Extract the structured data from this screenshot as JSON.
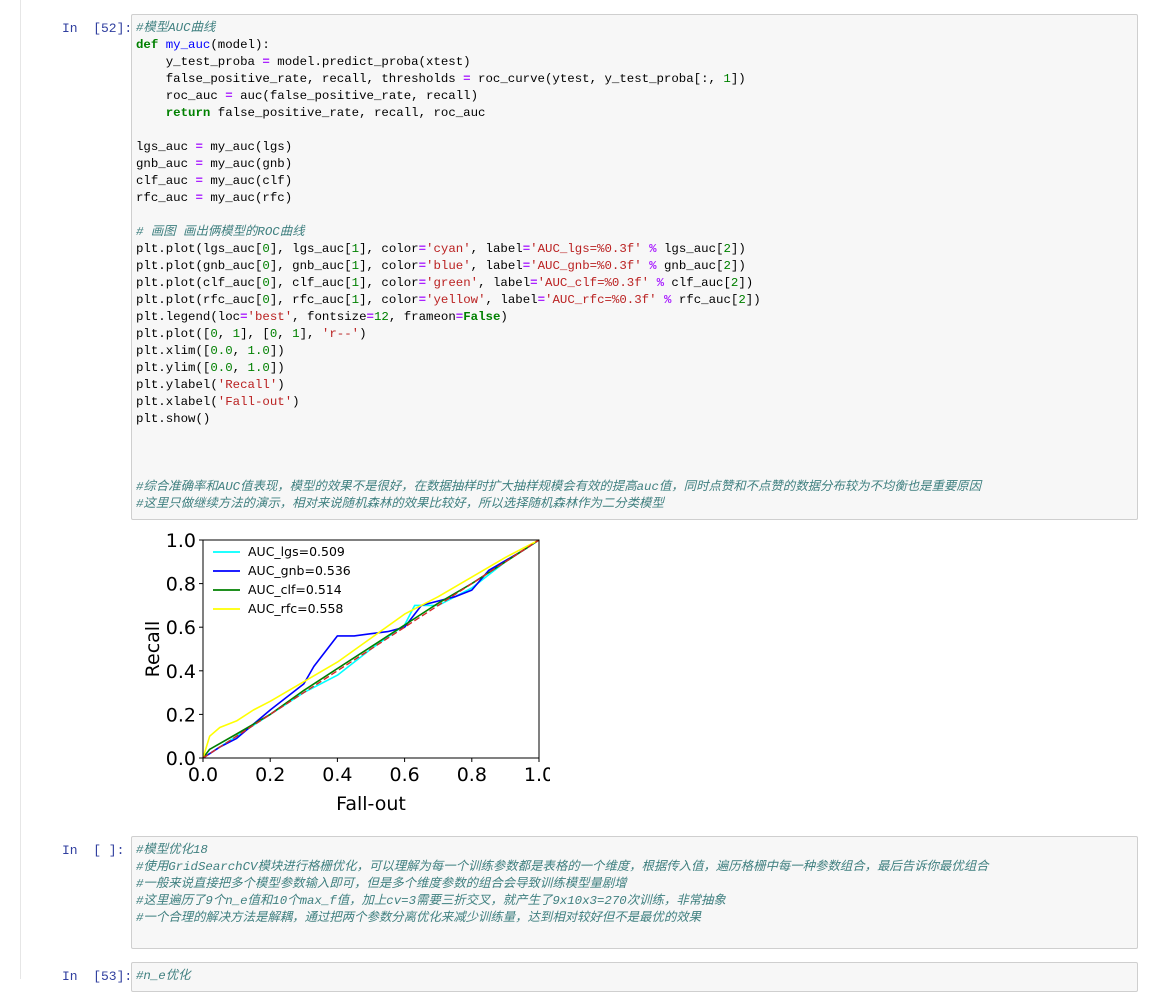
{
  "cells": [
    {
      "prompt": "In  [52]:",
      "lines": [
        [
          {
            "t": "#模型AUC曲线",
            "c": "cm"
          }
        ],
        [
          {
            "t": "def",
            "c": "kw"
          },
          {
            "t": " "
          },
          {
            "t": "my_auc",
            "c": "fn"
          },
          {
            "t": "(model):"
          }
        ],
        [
          {
            "t": "    y_test_proba "
          },
          {
            "t": "=",
            "c": "op"
          },
          {
            "t": " model.predict_proba(xtest)"
          }
        ],
        [
          {
            "t": "    false_positive_rate, recall, thresholds "
          },
          {
            "t": "=",
            "c": "op"
          },
          {
            "t": " roc_curve(ytest, y_test_proba[:, "
          },
          {
            "t": "1",
            "c": "nm"
          },
          {
            "t": "])"
          }
        ],
        [
          {
            "t": "    roc_auc "
          },
          {
            "t": "=",
            "c": "op"
          },
          {
            "t": " auc(false_positive_rate, recall)"
          }
        ],
        [
          {
            "t": "    "
          },
          {
            "t": "return",
            "c": "kw"
          },
          {
            "t": " false_positive_rate, recall, roc_auc"
          }
        ],
        [],
        [
          {
            "t": "lgs_auc "
          },
          {
            "t": "=",
            "c": "op"
          },
          {
            "t": " my_auc(lgs)"
          }
        ],
        [
          {
            "t": "gnb_auc "
          },
          {
            "t": "=",
            "c": "op"
          },
          {
            "t": " my_auc(gnb)"
          }
        ],
        [
          {
            "t": "clf_auc "
          },
          {
            "t": "=",
            "c": "op"
          },
          {
            "t": " my_auc(clf)"
          }
        ],
        [
          {
            "t": "rfc_auc "
          },
          {
            "t": "=",
            "c": "op"
          },
          {
            "t": " my_auc(rfc)"
          }
        ],
        [],
        [
          {
            "t": "# 画图 画出俩模型的ROC曲线",
            "c": "cm"
          }
        ],
        [
          {
            "t": "plt.plot(lgs_auc["
          },
          {
            "t": "0",
            "c": "nm"
          },
          {
            "t": "], lgs_auc["
          },
          {
            "t": "1",
            "c": "nm"
          },
          {
            "t": "], color"
          },
          {
            "t": "=",
            "c": "op"
          },
          {
            "t": "'cyan'",
            "c": "st"
          },
          {
            "t": ", label"
          },
          {
            "t": "=",
            "c": "op"
          },
          {
            "t": "'AUC_lgs=%0.3f'",
            "c": "st"
          },
          {
            "t": " "
          },
          {
            "t": "%",
            "c": "op"
          },
          {
            "t": " lgs_auc["
          },
          {
            "t": "2",
            "c": "nm"
          },
          {
            "t": "])"
          }
        ],
        [
          {
            "t": "plt.plot(gnb_auc["
          },
          {
            "t": "0",
            "c": "nm"
          },
          {
            "t": "], gnb_auc["
          },
          {
            "t": "1",
            "c": "nm"
          },
          {
            "t": "], color"
          },
          {
            "t": "=",
            "c": "op"
          },
          {
            "t": "'blue'",
            "c": "st"
          },
          {
            "t": ", label"
          },
          {
            "t": "=",
            "c": "op"
          },
          {
            "t": "'AUC_gnb=%0.3f'",
            "c": "st"
          },
          {
            "t": " "
          },
          {
            "t": "%",
            "c": "op"
          },
          {
            "t": " gnb_auc["
          },
          {
            "t": "2",
            "c": "nm"
          },
          {
            "t": "])"
          }
        ],
        [
          {
            "t": "plt.plot(clf_auc["
          },
          {
            "t": "0",
            "c": "nm"
          },
          {
            "t": "], clf_auc["
          },
          {
            "t": "1",
            "c": "nm"
          },
          {
            "t": "], color"
          },
          {
            "t": "=",
            "c": "op"
          },
          {
            "t": "'green'",
            "c": "st"
          },
          {
            "t": ", label"
          },
          {
            "t": "=",
            "c": "op"
          },
          {
            "t": "'AUC_clf=%0.3f'",
            "c": "st"
          },
          {
            "t": " "
          },
          {
            "t": "%",
            "c": "op"
          },
          {
            "t": " clf_auc["
          },
          {
            "t": "2",
            "c": "nm"
          },
          {
            "t": "])"
          }
        ],
        [
          {
            "t": "plt.plot(rfc_auc["
          },
          {
            "t": "0",
            "c": "nm"
          },
          {
            "t": "], rfc_auc["
          },
          {
            "t": "1",
            "c": "nm"
          },
          {
            "t": "], color"
          },
          {
            "t": "=",
            "c": "op"
          },
          {
            "t": "'yellow'",
            "c": "st"
          },
          {
            "t": ", label"
          },
          {
            "t": "=",
            "c": "op"
          },
          {
            "t": "'AUC_rfc=%0.3f'",
            "c": "st"
          },
          {
            "t": " "
          },
          {
            "t": "%",
            "c": "op"
          },
          {
            "t": " rfc_auc["
          },
          {
            "t": "2",
            "c": "nm"
          },
          {
            "t": "])"
          }
        ],
        [
          {
            "t": "plt.legend(loc"
          },
          {
            "t": "=",
            "c": "op"
          },
          {
            "t": "'best'",
            "c": "st"
          },
          {
            "t": ", fontsize"
          },
          {
            "t": "=",
            "c": "op"
          },
          {
            "t": "12",
            "c": "nm"
          },
          {
            "t": ", frameon"
          },
          {
            "t": "=",
            "c": "op"
          },
          {
            "t": "False",
            "c": "kc"
          },
          {
            "t": ")"
          }
        ],
        [
          {
            "t": "plt.plot(["
          },
          {
            "t": "0",
            "c": "nm"
          },
          {
            "t": ", "
          },
          {
            "t": "1",
            "c": "nm"
          },
          {
            "t": "], ["
          },
          {
            "t": "0",
            "c": "nm"
          },
          {
            "t": ", "
          },
          {
            "t": "1",
            "c": "nm"
          },
          {
            "t": "], "
          },
          {
            "t": "'r--'",
            "c": "st"
          },
          {
            "t": ")"
          }
        ],
        [
          {
            "t": "plt.xlim(["
          },
          {
            "t": "0.0",
            "c": "nm"
          },
          {
            "t": ", "
          },
          {
            "t": "1.0",
            "c": "nm"
          },
          {
            "t": "])"
          }
        ],
        [
          {
            "t": "plt.ylim(["
          },
          {
            "t": "0.0",
            "c": "nm"
          },
          {
            "t": ", "
          },
          {
            "t": "1.0",
            "c": "nm"
          },
          {
            "t": "])"
          }
        ],
        [
          {
            "t": "plt.ylabel("
          },
          {
            "t": "'Recall'",
            "c": "st"
          },
          {
            "t": ")"
          }
        ],
        [
          {
            "t": "plt.xlabel("
          },
          {
            "t": "'Fall-out'",
            "c": "st"
          },
          {
            "t": ")"
          }
        ],
        [
          {
            "t": "plt.show()"
          }
        ],
        [],
        [],
        [],
        [
          {
            "t": "#综合准确率和AUC值表现，模型的效果不是很好，在数据抽样时扩大抽样规模会有效的提高auc值，同时点赞和不点赞的数据分布较为不均衡也是重要原因",
            "c": "cm"
          }
        ],
        [
          {
            "t": "#这里只做继续方法的演示，相对来说随机森林的效果比较好，所以选择随机森林作为二分类模型",
            "c": "cm"
          }
        ]
      ]
    },
    {
      "prompt": "In  [ ]:",
      "lines": [
        [
          {
            "t": "#模型优化18",
            "c": "cm"
          }
        ],
        [
          {
            "t": "#使用GridSearchCV模块进行格栅优化，可以理解为每一个训练参数都是表格的一个维度，根据传入值，遍历格栅中每一种参数组合，最后告诉你最优组合",
            "c": "cm"
          }
        ],
        [
          {
            "t": "#一般来说直接把多个模型参数输入即可，但是多个维度参数的组合会导致训练模型量剧增",
            "c": "cm"
          }
        ],
        [
          {
            "t": "#这里遍历了9个n_e值和10个max_f值，加上cv=3需要三折交叉，就产生了9x10x3=270次训练，非常抽象",
            "c": "cm"
          }
        ],
        [
          {
            "t": "#一个合理的解决方法是解耦，通过把两个参数分离优化来减少训练量，达到相对较好但不是最优的效果",
            "c": "cm"
          }
        ],
        []
      ]
    },
    {
      "prompt": "In  [53]:",
      "lines": [
        [
          {
            "t": "#n_e优化",
            "c": "cm"
          }
        ]
      ]
    }
  ],
  "chart_data": {
    "type": "line",
    "xlabel": "Fall-out",
    "ylabel": "Recall",
    "xlim": [
      0.0,
      1.0
    ],
    "ylim": [
      0.0,
      1.0
    ],
    "xticks": [
      "0.0",
      "0.2",
      "0.4",
      "0.6",
      "0.8",
      "1.0"
    ],
    "yticks": [
      "0.0",
      "0.2",
      "0.4",
      "0.6",
      "0.8",
      "1.0"
    ],
    "legend_position": "top-left",
    "series": [
      {
        "name": "AUC_lgs=0.509",
        "color": "#00ffff",
        "x": [
          0.0,
          0.05,
          0.1,
          0.2,
          0.3,
          0.4,
          0.5,
          0.6,
          0.63,
          0.7,
          0.8,
          0.9,
          0.97,
          1.0
        ],
        "y": [
          0.0,
          0.05,
          0.1,
          0.2,
          0.3,
          0.38,
          0.5,
          0.61,
          0.7,
          0.7,
          0.78,
          0.9,
          0.97,
          1.0
        ]
      },
      {
        "name": "AUC_gnb=0.536",
        "color": "#0000ff",
        "x": [
          0.0,
          0.05,
          0.1,
          0.2,
          0.3,
          0.33,
          0.4,
          0.45,
          0.5,
          0.55,
          0.6,
          0.65,
          0.75,
          0.8,
          0.85,
          0.95,
          1.0
        ],
        "y": [
          0.0,
          0.05,
          0.09,
          0.22,
          0.34,
          0.42,
          0.56,
          0.56,
          0.57,
          0.58,
          0.6,
          0.7,
          0.74,
          0.77,
          0.86,
          0.95,
          1.0
        ]
      },
      {
        "name": "AUC_clf=0.514",
        "color": "#008000",
        "x": [
          0.0,
          0.02,
          0.1,
          0.2,
          0.3,
          0.4,
          0.5,
          0.6,
          0.7,
          0.8,
          0.9,
          1.0
        ],
        "y": [
          0.0,
          0.04,
          0.11,
          0.2,
          0.31,
          0.41,
          0.51,
          0.61,
          0.71,
          0.8,
          0.9,
          1.0
        ]
      },
      {
        "name": "AUC_rfc=0.558",
        "color": "#ffff00",
        "x": [
          0.0,
          0.02,
          0.05,
          0.1,
          0.15,
          0.2,
          0.3,
          0.4,
          0.5,
          0.6,
          0.7,
          0.8,
          0.9,
          1.0
        ],
        "y": [
          0.0,
          0.1,
          0.14,
          0.17,
          0.22,
          0.26,
          0.35,
          0.44,
          0.55,
          0.66,
          0.74,
          0.83,
          0.92,
          1.0
        ]
      },
      {
        "name": "",
        "color": "#d62728",
        "dashed": true,
        "x": [
          0.0,
          1.0
        ],
        "y": [
          0.0,
          1.0
        ]
      }
    ]
  }
}
